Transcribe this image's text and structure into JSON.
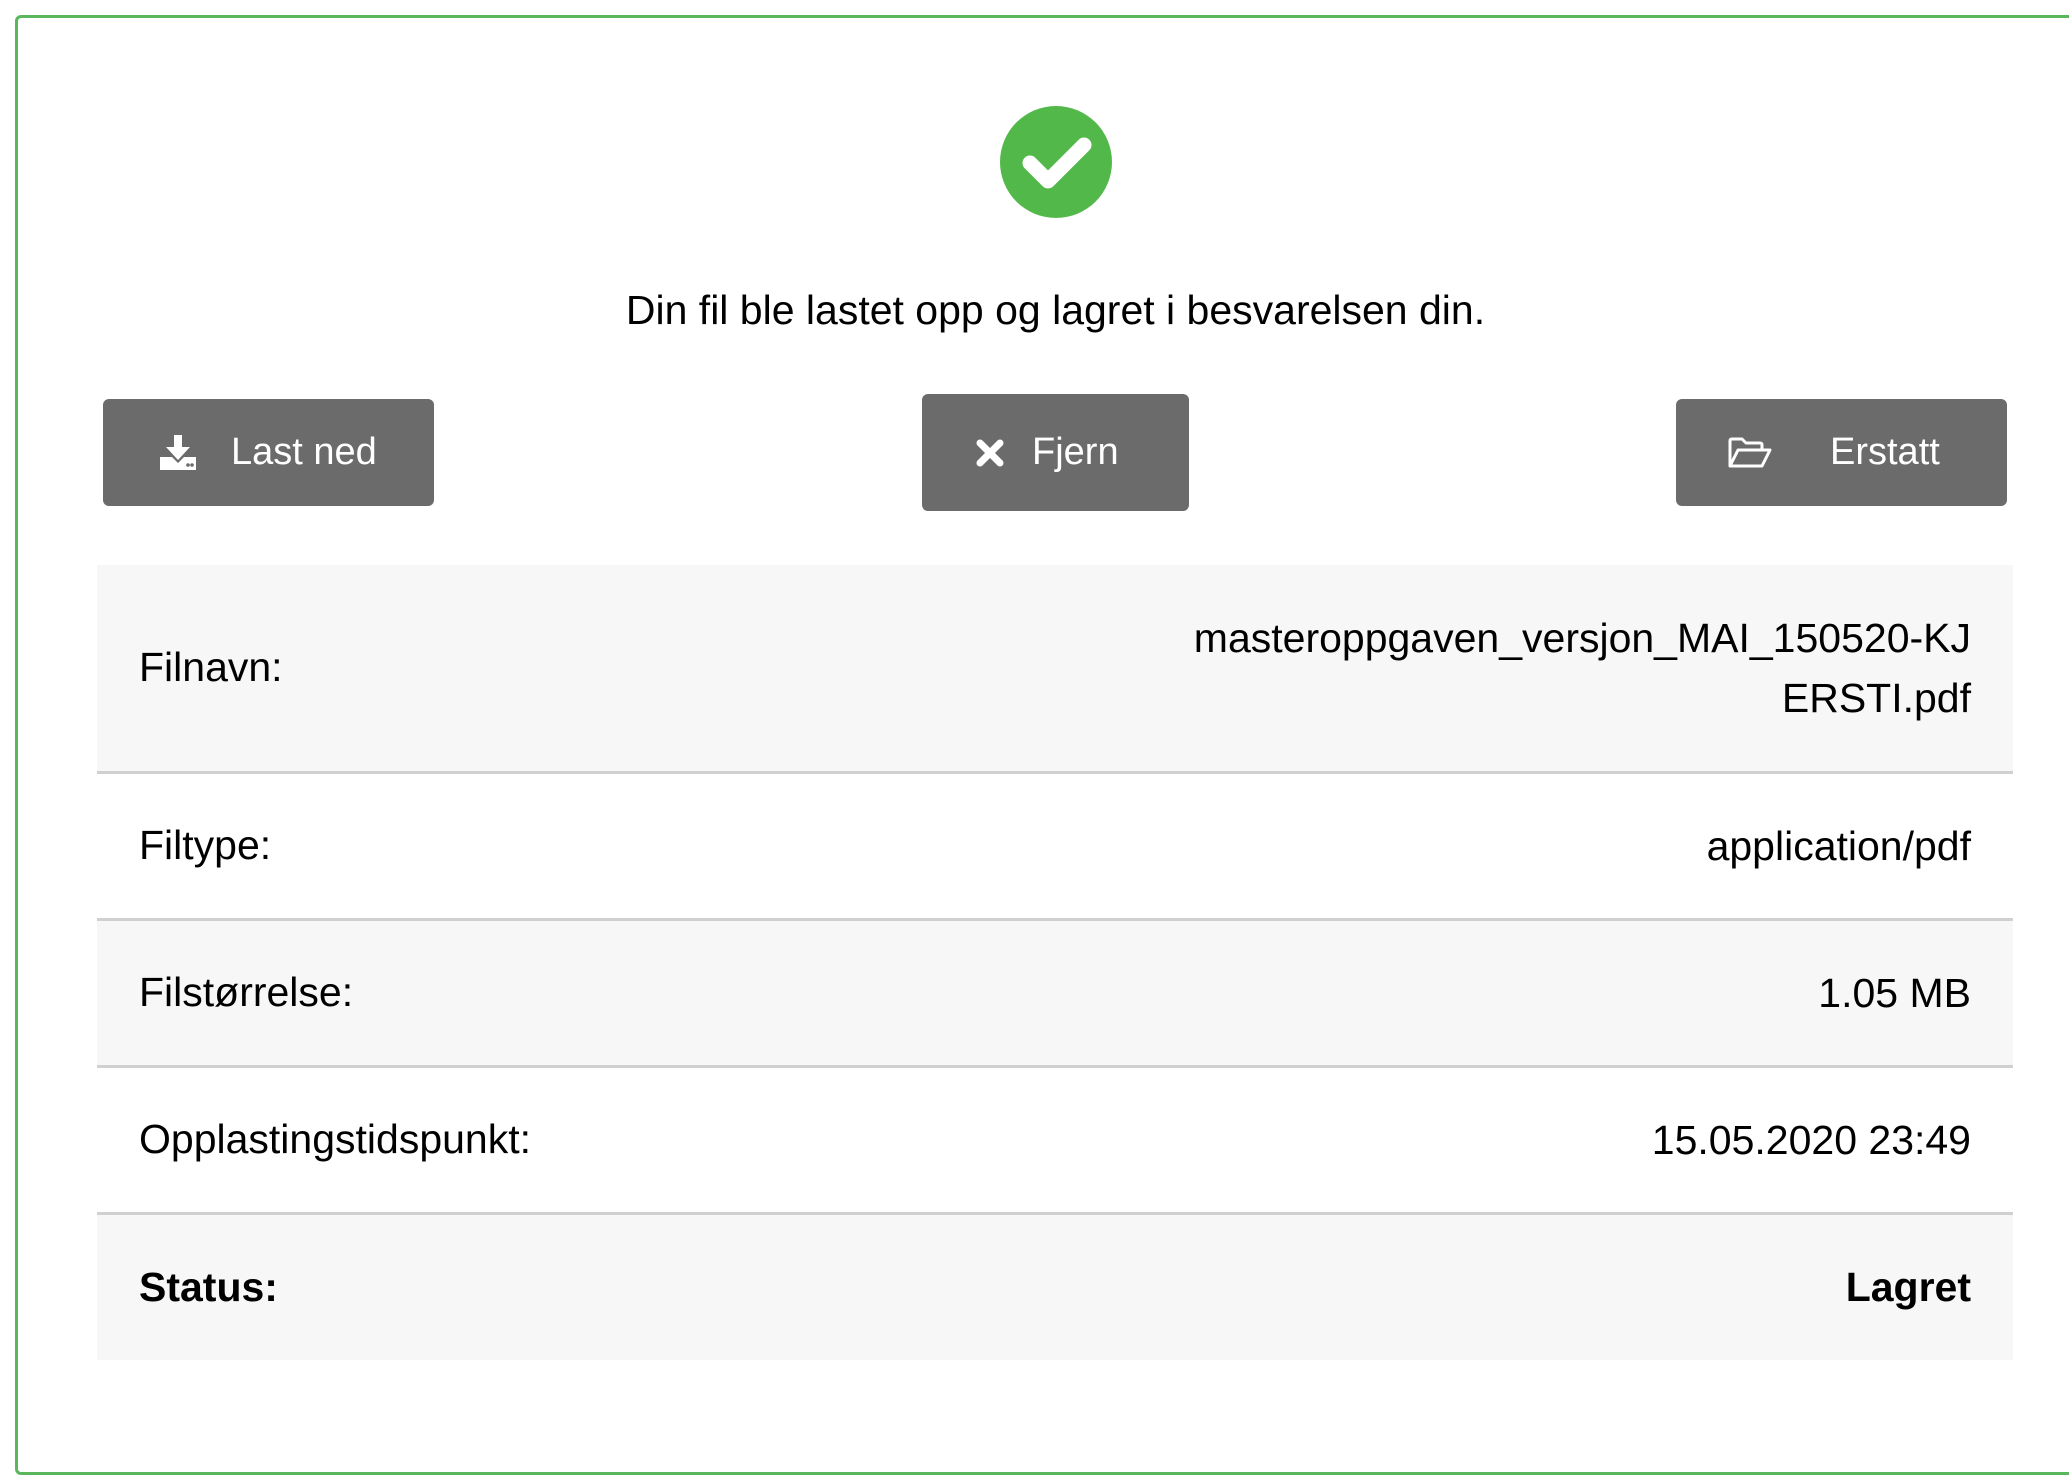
{
  "upload": {
    "status_icon": "check-circle-icon",
    "message": "Din fil ble lastet opp og lagret i besvarelsen din."
  },
  "actions": {
    "download": {
      "label": "Last ned",
      "icon": "download-icon"
    },
    "remove": {
      "label": "Fjern",
      "icon": "close-icon"
    },
    "replace": {
      "label": "Erstatt",
      "icon": "folder-open-icon"
    }
  },
  "file_info": {
    "filename": {
      "label": "Filnavn:",
      "value": "masteroppgaven_versjon_MAI_150520-KJERSTI.pdf"
    },
    "filetype": {
      "label": "Filtype:",
      "value": "application/pdf"
    },
    "filesize": {
      "label": "Filstørrelse:",
      "value": "1.05 MB"
    },
    "uploaded_at": {
      "label": "Opplastingstidspunkt:",
      "value": "15.05.2020 23:49"
    },
    "status": {
      "label": "Status:",
      "value": "Lagret"
    }
  },
  "colors": {
    "success": "#53b84a",
    "panel_border": "#5bb75b",
    "button_bg": "#6b6b6b",
    "row_shaded": "#f7f7f7",
    "divider": "#d0d0d0"
  }
}
